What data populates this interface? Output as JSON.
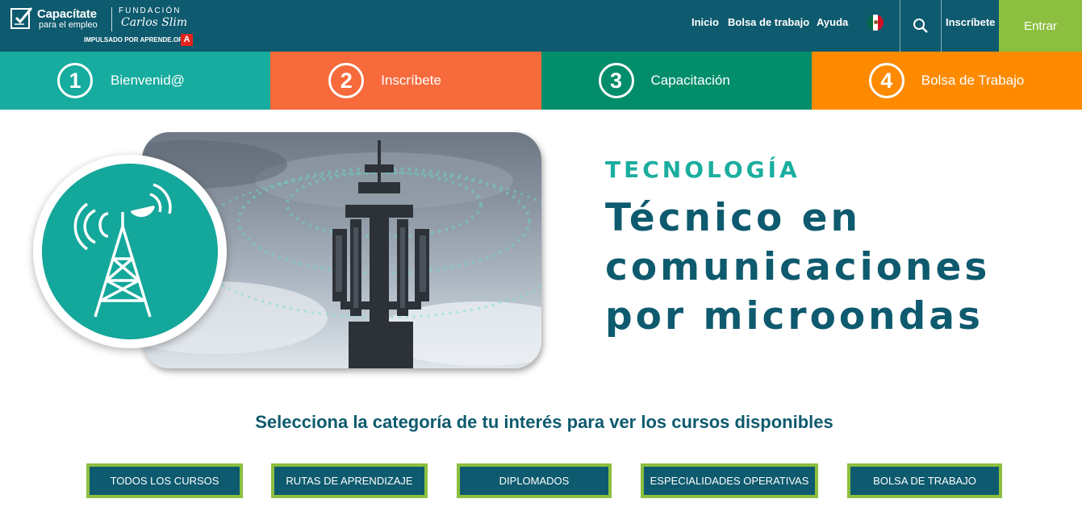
{
  "header": {
    "logo": {
      "brand_line1": "Capacítate",
      "brand_line2": "para el empleo",
      "foundation": "FUNDACIÓN",
      "foundation_name": "Carlos Slim",
      "powered_by": "IMPULSADO POR APRENDE.ORG",
      "badge_letter": "A"
    },
    "nav": {
      "inicio": "Inicio",
      "bolsa": "Bolsa de trabajo",
      "ayuda": "Ayuda",
      "inscribete": "Inscríbete",
      "entrar": "Entrar"
    },
    "country_flag": "mexico-flag-icon"
  },
  "steps": [
    {
      "number": "1",
      "label": "Bienvenid@",
      "color": "#16ac9f"
    },
    {
      "number": "2",
      "label": "Inscríbete",
      "color": "#f76a3b"
    },
    {
      "number": "3",
      "label": "Capacitación",
      "color": "#028d6b"
    },
    {
      "number": "4",
      "label": "Bolsa de Trabajo",
      "color": "#fe8a00"
    }
  ],
  "hero": {
    "category": "TECNOLOGÍA",
    "title": "Técnico en comunicaciones por microondas",
    "icon": "antenna-tower-icon"
  },
  "categories": {
    "heading": "Selecciona la categoría de tu interés para ver los cursos disponibles",
    "buttons": [
      "TODOS LOS CURSOS",
      "RUTAS DE APRENDIZAJE",
      "DIPLOMADOS",
      "ESPECIALIDADES OPERATIVAS",
      "BOLSA DE TRABAJO"
    ]
  },
  "colors": {
    "primary": "#0e5a6e",
    "accent_green": "#8cbf3f",
    "teal": "#14a79b"
  }
}
